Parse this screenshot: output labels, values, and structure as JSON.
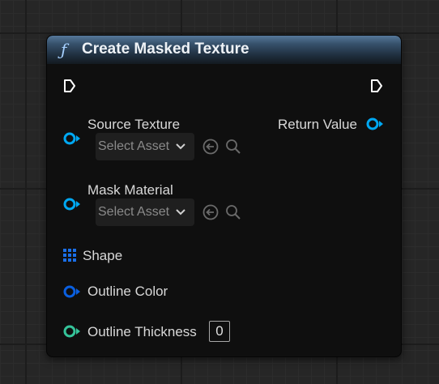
{
  "node": {
    "title": "Create Masked Texture",
    "function_icon": "function-icon",
    "return_label": "Return Value",
    "inputs": {
      "source_texture": {
        "label": "Source Texture",
        "asset_placeholder": "Select Asset"
      },
      "mask_material": {
        "label": "Mask Material",
        "asset_placeholder": "Select Asset"
      },
      "shape": {
        "label": "Shape"
      },
      "outline_color": {
        "label": "Outline Color"
      },
      "outline_thickness": {
        "label": "Outline Thickness",
        "value": "0"
      }
    }
  },
  "colors": {
    "object_pin": "#00a8f2",
    "struct_pin": "#0a5fe0",
    "float_pin": "#35c49a",
    "exec_pin": "#ffffff"
  }
}
